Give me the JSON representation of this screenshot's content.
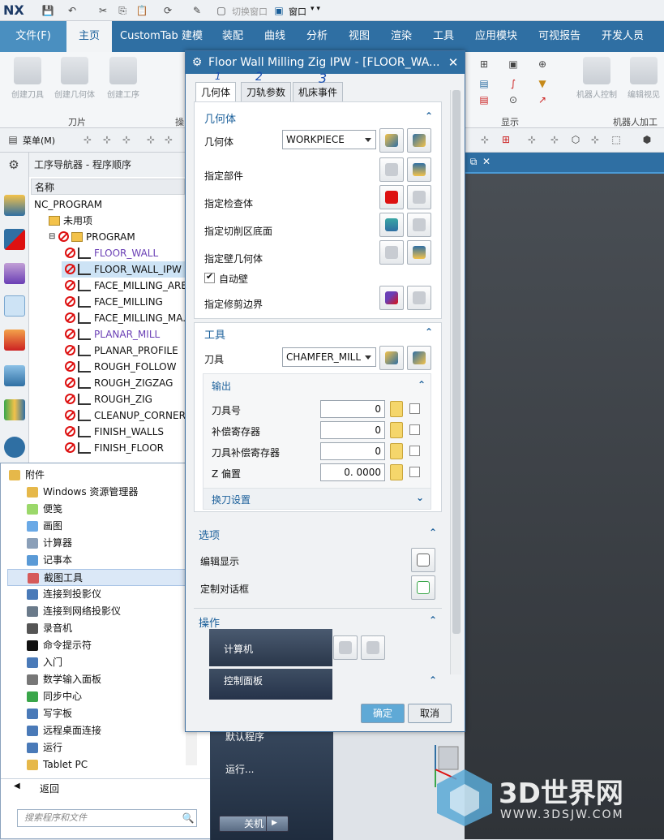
{
  "qat": {
    "logo": "NX",
    "switch_window": "切换窗口",
    "window_menu": "窗口"
  },
  "ribbon": {
    "tabs": [
      "文件(F)",
      "主页",
      "CustomTab 建模",
      "装配",
      "曲线",
      "分析",
      "视图",
      "渲染",
      "工具",
      "应用模块",
      "可视报告",
      "开发人员"
    ],
    "buttons": [
      "创建刀具",
      "创建几何体",
      "创建工序"
    ],
    "groups": {
      "tool": "刀片",
      "display": "显示",
      "robot": "机器人加工",
      "op": "操"
    },
    "robot_buttons": [
      "机器人控制",
      "编辑视见"
    ],
    "menu": "菜单(M)"
  },
  "navigator": {
    "title": "工序导航器 - 程序顺序",
    "col": "名称",
    "rows": [
      {
        "label": "NC_PROGRAM",
        "indent": 0,
        "type": "root"
      },
      {
        "label": "未用项",
        "indent": 1,
        "type": "folder"
      },
      {
        "label": "PROGRAM",
        "indent": 1,
        "type": "program"
      },
      {
        "label": "FLOOR_WALL",
        "indent": 2,
        "type": "op",
        "color": "purple"
      },
      {
        "label": "FLOOR_WALL_IPW",
        "indent": 2,
        "type": "op",
        "selected": true
      },
      {
        "label": "FACE_MILLING_AREA",
        "indent": 2,
        "type": "op"
      },
      {
        "label": "FACE_MILLING",
        "indent": 2,
        "type": "op"
      },
      {
        "label": "FACE_MILLING_MA...",
        "indent": 2,
        "type": "op"
      },
      {
        "label": "PLANAR_MILL",
        "indent": 2,
        "type": "op",
        "color": "purple"
      },
      {
        "label": "PLANAR_PROFILE",
        "indent": 2,
        "type": "op"
      },
      {
        "label": "ROUGH_FOLLOW",
        "indent": 2,
        "type": "op"
      },
      {
        "label": "ROUGH_ZIGZAG",
        "indent": 2,
        "type": "op"
      },
      {
        "label": "ROUGH_ZIG",
        "indent": 2,
        "type": "op"
      },
      {
        "label": "CLEANUP_CORNERS",
        "indent": 2,
        "type": "op"
      },
      {
        "label": "FINISH_WALLS",
        "indent": 2,
        "type": "op"
      },
      {
        "label": "FINISH_FLOOR",
        "indent": 2,
        "type": "op"
      }
    ]
  },
  "startmenu": {
    "items": [
      {
        "label": "附件",
        "icon": "folder-icon",
        "color": "#e6b84a"
      },
      {
        "label": "Windows 资源管理器",
        "icon": "explorer-icon",
        "color": "#e6b84a"
      },
      {
        "label": "便笺",
        "icon": "sticky-note-icon",
        "color": "#9bd86a"
      },
      {
        "label": "画图",
        "icon": "paint-icon",
        "color": "#6aa9e6"
      },
      {
        "label": "计算器",
        "icon": "calculator-icon",
        "color": "#8a9fb8"
      },
      {
        "label": "记事本",
        "icon": "notepad-icon",
        "color": "#5a9ad6"
      },
      {
        "label": "截图工具",
        "icon": "snipping-tool-icon",
        "color": "#d65a5a"
      },
      {
        "label": "连接到投影仪",
        "icon": "projector-icon",
        "color": "#4a7ab8"
      },
      {
        "label": "连接到网络投影仪",
        "icon": "network-projector-icon",
        "color": "#6a7a8a"
      },
      {
        "label": "录音机",
        "icon": "microphone-icon",
        "color": "#555555"
      },
      {
        "label": "命令提示符",
        "icon": "cmd-icon",
        "color": "#111111"
      },
      {
        "label": "入门",
        "icon": "getting-started-icon",
        "color": "#4a7ab8"
      },
      {
        "label": "数学输入面板",
        "icon": "math-panel-icon",
        "color": "#777777"
      },
      {
        "label": "同步中心",
        "icon": "sync-center-icon",
        "color": "#3aa64a"
      },
      {
        "label": "写字板",
        "icon": "wordpad-icon",
        "color": "#4a7ab8"
      },
      {
        "label": "远程桌面连接",
        "icon": "remote-desktop-icon",
        "color": "#4a7ab8"
      },
      {
        "label": "运行",
        "icon": "run-icon",
        "color": "#4a7ab8"
      },
      {
        "label": "Tablet PC",
        "icon": "folder-icon",
        "color": "#e6b84a"
      }
    ],
    "highlighted_index": 6,
    "back": "返回",
    "search_placeholder": "搜索程序和文件",
    "right": {
      "computer": "计算机",
      "control_panel": "控制面板",
      "default_programs": "默认程序",
      "run": "运行...",
      "shutdown": "关机"
    }
  },
  "dialog": {
    "title": "Floor Wall Milling Zig IPW - [FLOOR_WA...",
    "tabs": [
      "几何体",
      "刀轨参数",
      "机床事件"
    ],
    "annotations": [
      "1",
      "2",
      "3"
    ],
    "geometry": {
      "section": "几何体",
      "geometry_label": "几何体",
      "geometry_value": "WORKPIECE",
      "rows": [
        "指定部件",
        "指定检查体",
        "指定切削区底面",
        "指定壁几何体"
      ],
      "auto_wall": "自动壁",
      "trim": "指定修剪边界"
    },
    "tool": {
      "section": "工具",
      "tool_label": "刀具",
      "tool_value": "CHAMFER_MILL",
      "output": "输出",
      "fields": [
        {
          "label": "刀具号",
          "value": "0"
        },
        {
          "label": "补偿寄存器",
          "value": "0"
        },
        {
          "label": "刀具补偿寄存器",
          "value": "0"
        },
        {
          "label": "Z 偏置",
          "value": "0. 0000"
        }
      ],
      "change": "换刀设置"
    },
    "options": {
      "section": "选项",
      "edit_display": "编辑显示",
      "custom_dialog": "定制对话框"
    },
    "actions": {
      "section": "操作"
    },
    "ok": "确定",
    "cancel": "取消"
  },
  "watermark": {
    "text": "3D世界网",
    "url": "WWW.3DSJW.COM"
  }
}
